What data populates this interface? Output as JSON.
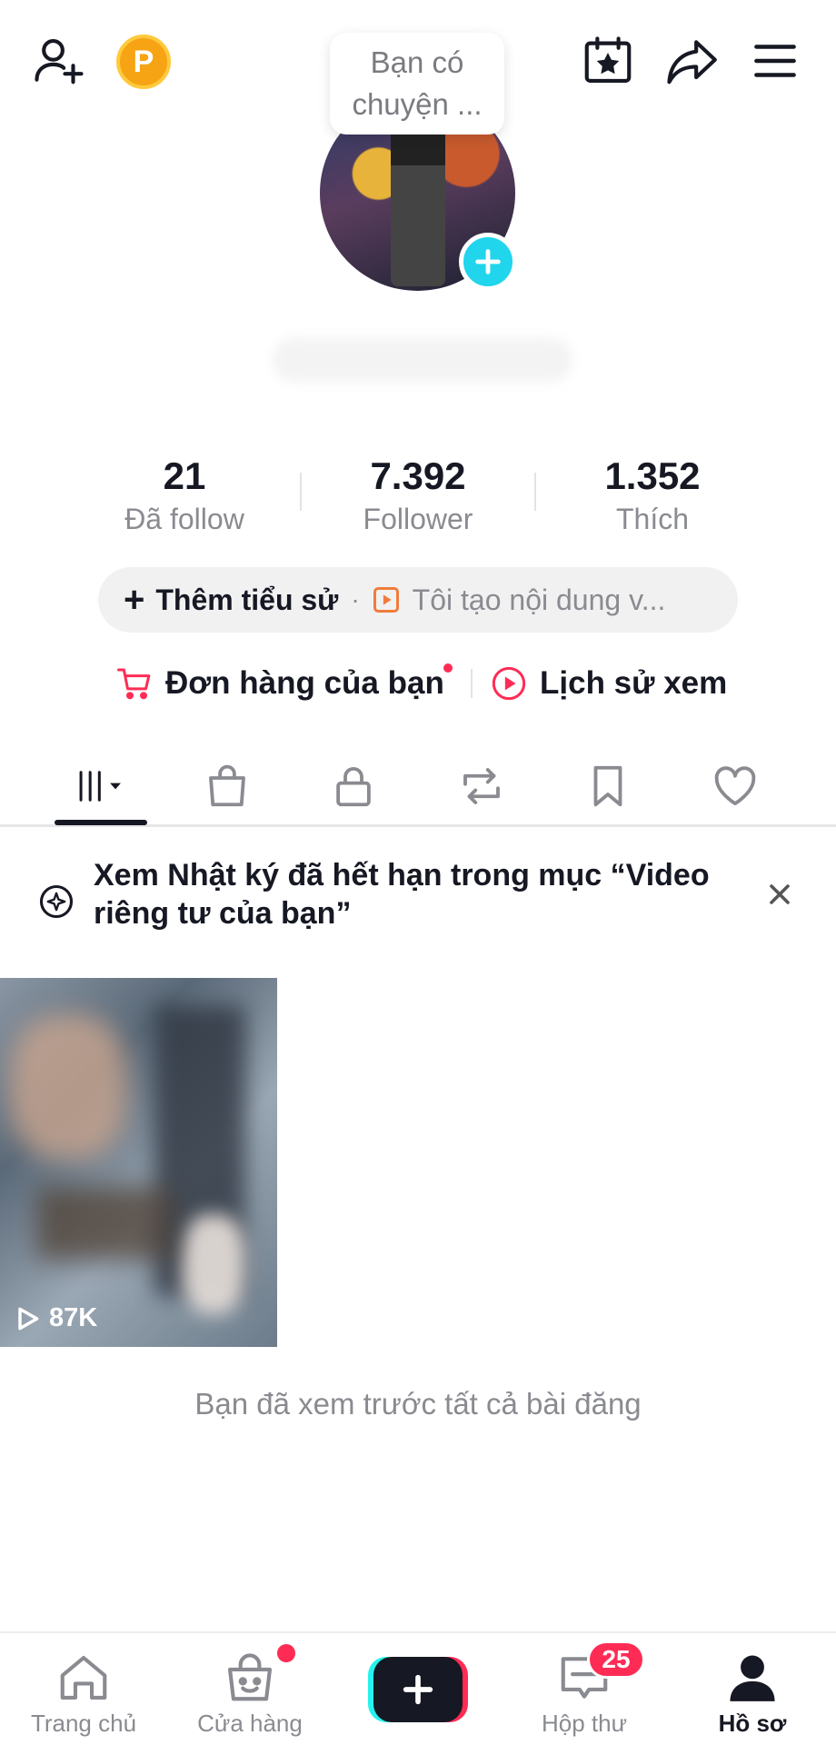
{
  "header": {
    "coin_label": "P",
    "story_bubble_line1": "Bạn có",
    "story_bubble_line2": "chuyện ..."
  },
  "stats": [
    {
      "value": "21",
      "label": "Đã follow"
    },
    {
      "value": "7.392",
      "label": "Follower"
    },
    {
      "value": "1.352",
      "label": "Thích"
    }
  ],
  "bio": {
    "plus": "+",
    "add_bio_label": "Thêm tiểu sử",
    "separator": "·",
    "about_text": "Tôi tạo nội dung v..."
  },
  "links": {
    "orders_label": "Đơn hàng của bạn",
    "history_label": "Lịch sử xem"
  },
  "tabs": [
    "videos-grid",
    "shop",
    "private",
    "reposts",
    "favorites",
    "liked"
  ],
  "notice": {
    "text": "Xem Nhật ký đã hết hạn trong mục “Video riêng tư của bạn”"
  },
  "videos": [
    {
      "views": "87K"
    }
  ],
  "end_text": "Bạn đã xem trước tất cả bài đăng",
  "bottom_nav": {
    "home": "Trang chủ",
    "shop": "Cửa hàng",
    "inbox": "Hộp thư",
    "inbox_badge": "25",
    "profile": "Hồ sơ"
  },
  "colors": {
    "accent_red": "#fe2c55",
    "accent_cyan": "#20d5ec",
    "text_primary": "#161823",
    "text_secondary": "#8a8b91",
    "coin": "#f6a413"
  }
}
